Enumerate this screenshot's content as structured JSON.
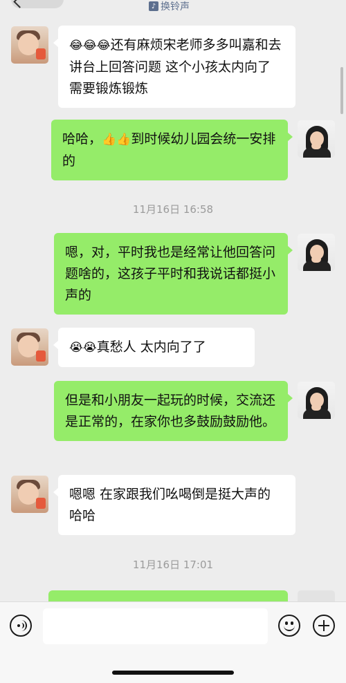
{
  "header": {
    "ringtone_icon": "ringtone-icon",
    "ringtone_icon_glyph": "♪",
    "ringtone_label": "换铃声"
  },
  "messages": [
    {
      "side": "in",
      "avatar": "kid-avatar",
      "emoji": "😂😂😂",
      "text": "还有麻烦宋老师多多叫嘉和去讲台上回答问题 这个小孩太内向了 需要锻炼锻炼"
    },
    {
      "side": "out",
      "avatar": "my-avatar",
      "prefix": "哈哈，",
      "emoji": "👍👍",
      "text": "到时候幼儿园会统一安排的"
    },
    {
      "type": "time",
      "text": "11月16日 16:58"
    },
    {
      "side": "out",
      "avatar": "my-avatar",
      "text": "嗯，对，平时我也是经常让他回答问题啥的，这孩子平时和我说话都挺小声的"
    },
    {
      "side": "in",
      "avatar": "kid-avatar",
      "emoji": "😭😭",
      "text": "真愁人 太内向了了"
    },
    {
      "side": "out",
      "avatar": "my-avatar",
      "text": "但是和小朋友一起玩的时候，交流还是正常的，在家你也多鼓励鼓励他。"
    },
    {
      "side": "in",
      "avatar": "kid-avatar",
      "text": "嗯嗯 在家跟我们吆喝倒是挺大声的 哈哈"
    },
    {
      "type": "time",
      "text": "11月16日 17:01"
    }
  ],
  "input_bar": {
    "voice_icon": "voice-icon",
    "input_value": "",
    "emoji_icon": "emoji-icon",
    "plus_icon": "plus-icon"
  },
  "colors": {
    "background": "#ededed",
    "incoming_bubble": "#ffffff",
    "outgoing_bubble": "#95ec69",
    "timestamp": "#9b9b9b",
    "ringtone": "#5d6f8e"
  }
}
